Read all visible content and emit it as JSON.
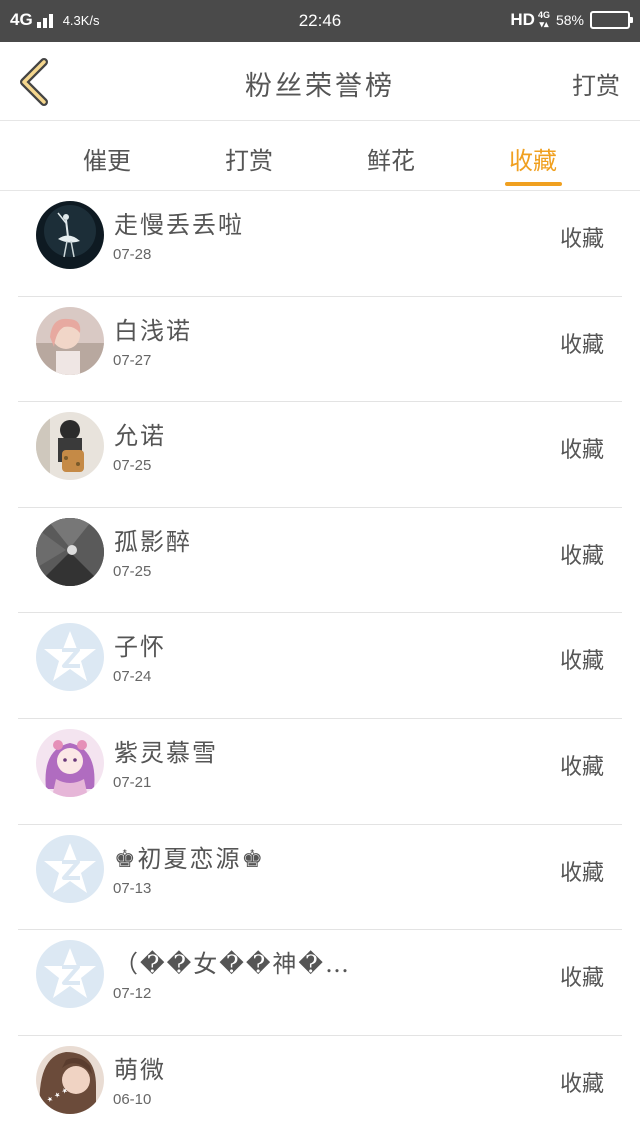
{
  "status_bar": {
    "network": "4G",
    "speed": "4.3K/s",
    "time": "22:46",
    "hd": "HD",
    "net_small": "4G",
    "battery": "58%",
    "battery_level": 0.58
  },
  "header": {
    "title": "粉丝荣誉榜",
    "action": "打赏"
  },
  "tabs": [
    {
      "label": "催更",
      "active": false
    },
    {
      "label": "打赏",
      "active": false
    },
    {
      "label": "鲜花",
      "active": false
    },
    {
      "label": "收藏",
      "active": true
    }
  ],
  "accent_color": "#f0a020",
  "rows": [
    {
      "name": "走慢丢丢啦",
      "date": "07-28",
      "action": "收藏",
      "avatar": "ballerina-photo"
    },
    {
      "name": "白浅诺",
      "date": "07-27",
      "action": "收藏",
      "avatar": "girl-photo"
    },
    {
      "name": "允诺",
      "date": "07-25",
      "action": "收藏",
      "avatar": "backpack-girl-photo"
    },
    {
      "name": "孤影醉",
      "date": "07-25",
      "action": "收藏",
      "avatar": "tunnel-photo"
    },
    {
      "name": "子怀",
      "date": "07-24",
      "action": "收藏",
      "avatar": "default-qq-icon"
    },
    {
      "name": "紫灵慕雪",
      "date": "07-21",
      "action": "收藏",
      "avatar": "anime-girl-photo"
    },
    {
      "name": "♚初夏恋源♚",
      "date": "07-13",
      "action": "收藏",
      "avatar": "default-qq-icon"
    },
    {
      "name": "（��女��神�…",
      "date": "07-12",
      "action": "收藏",
      "avatar": "default-qq-icon"
    },
    {
      "name": "萌微",
      "date": "06-10",
      "action": "收藏",
      "avatar": "hair-girl-photo"
    }
  ]
}
